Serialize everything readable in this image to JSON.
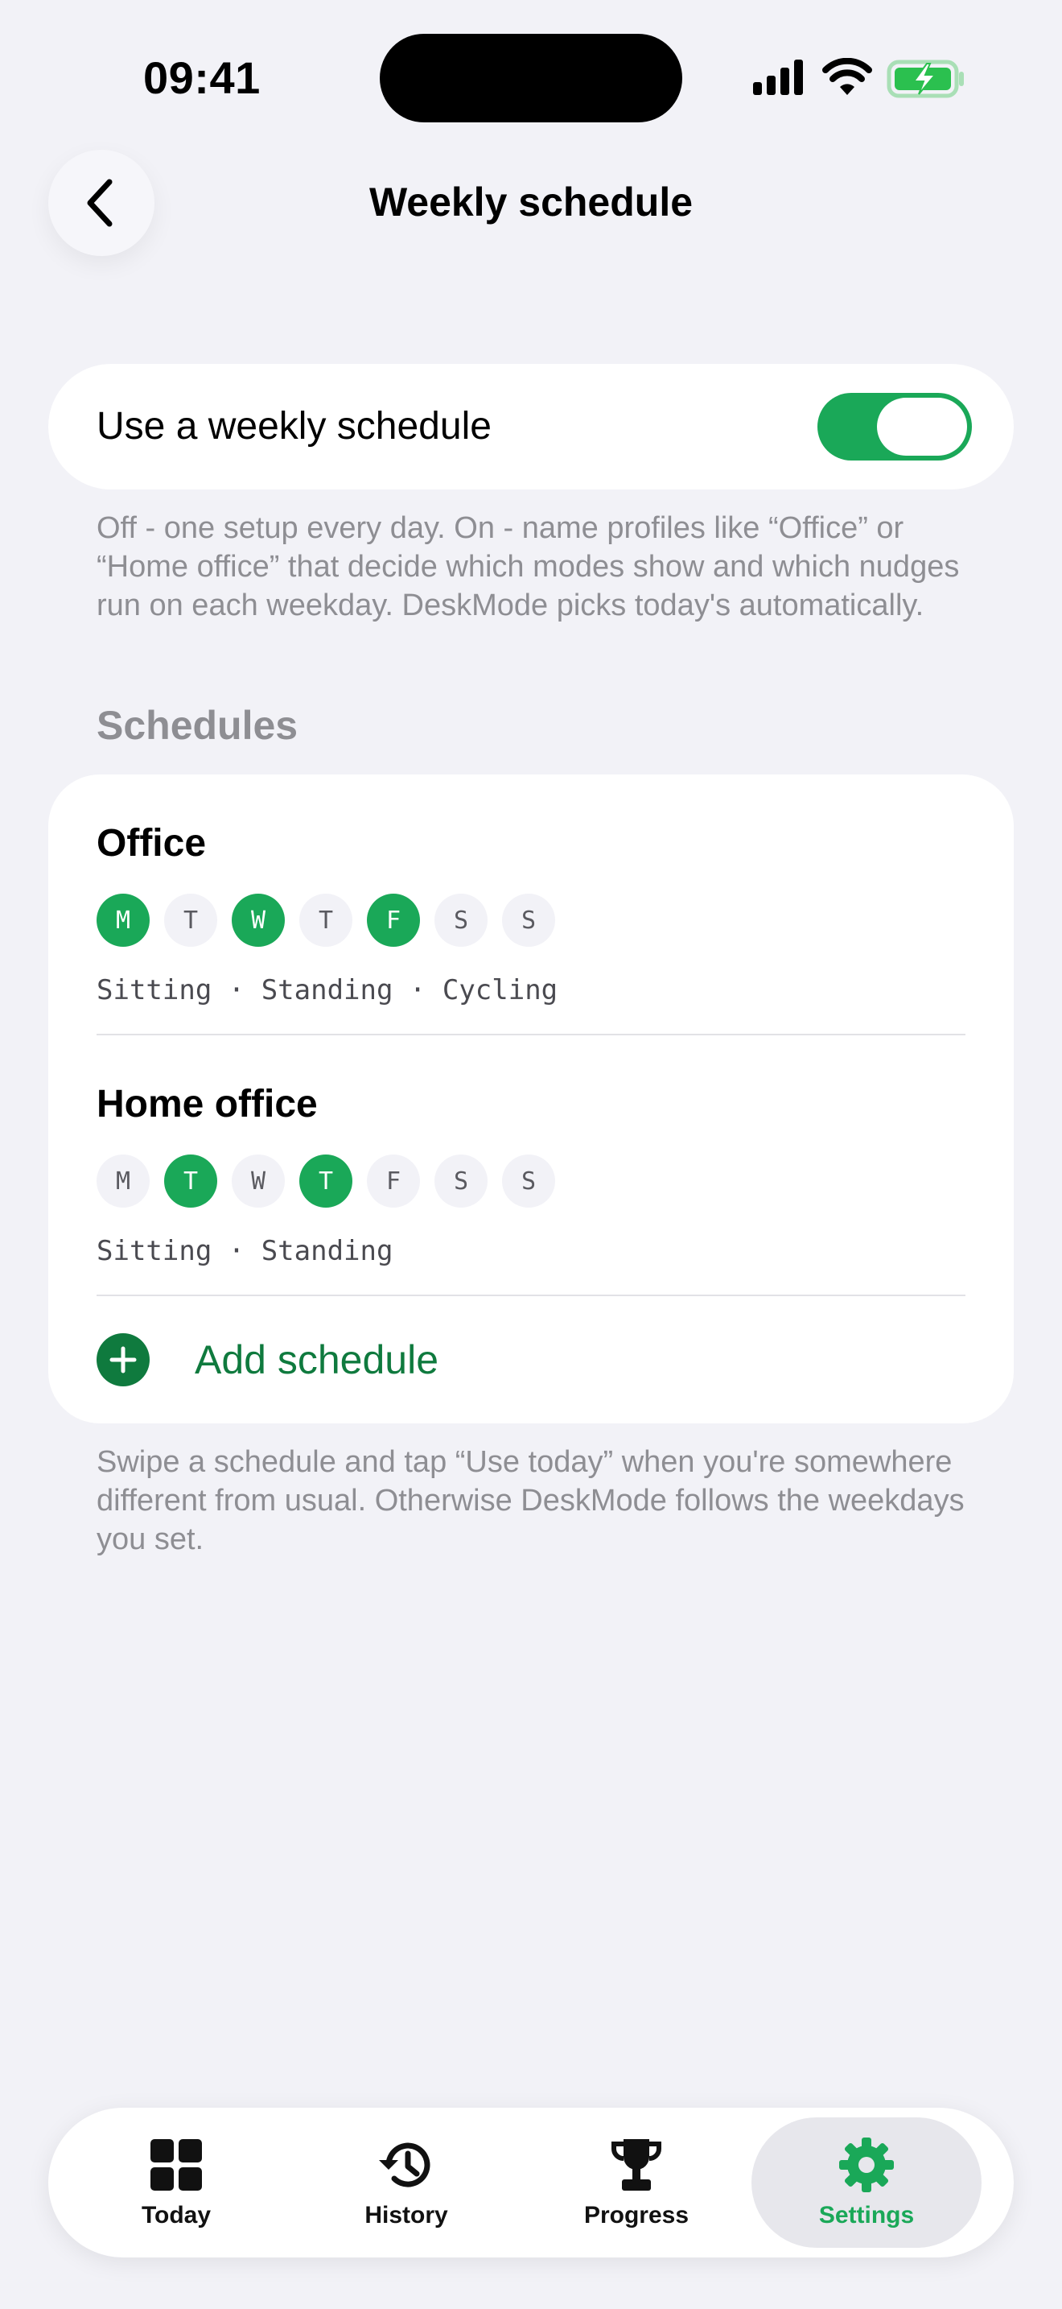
{
  "status_bar": {
    "time": "09:41"
  },
  "header": {
    "title": "Weekly schedule"
  },
  "weekly_toggle": {
    "label": "Use a weekly schedule",
    "enabled": true,
    "description": "Off - one setup every day. On - name profiles like “Office” or “Home office” that decide which modes show and which nudges run on each weekday. DeskMode picks today's automatically."
  },
  "schedules_section": {
    "header": "Schedules",
    "items": [
      {
        "name": "Office",
        "days": [
          "M",
          "T",
          "W",
          "T",
          "F",
          "S",
          "S"
        ],
        "active": [
          true,
          false,
          true,
          false,
          true,
          false,
          false
        ],
        "modes": "Sitting · Standing · Cycling"
      },
      {
        "name": "Home office",
        "days": [
          "M",
          "T",
          "W",
          "T",
          "F",
          "S",
          "S"
        ],
        "active": [
          false,
          true,
          false,
          true,
          false,
          false,
          false
        ],
        "modes": "Sitting · Standing"
      }
    ],
    "add_label": "Add schedule",
    "footer": "Swipe a schedule and tap “Use today” when you're somewhere different from usual. Otherwise DeskMode follows the weekdays you set."
  },
  "tab_bar": {
    "tabs": [
      {
        "label": "Today",
        "icon": "grid-icon"
      },
      {
        "label": "History",
        "icon": "history-icon"
      },
      {
        "label": "Progress",
        "icon": "trophy-icon"
      },
      {
        "label": "Settings",
        "icon": "gear-icon"
      }
    ],
    "active_index": 3
  },
  "colors": {
    "accent": "#1aa858",
    "accent_dark": "#0f7a3e",
    "background": "#f2f2f7"
  }
}
